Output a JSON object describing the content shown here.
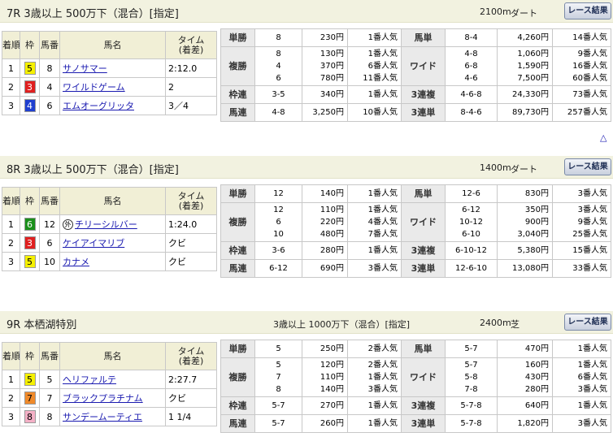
{
  "colors": {
    "header_bg": "#f2f2e0",
    "link": "#1a1ab0",
    "waku5": "#f5f000",
    "waku3": "#e02020",
    "waku4": "#1f3fd0",
    "waku6": "#1a8f1a",
    "waku7": "#f08a2a",
    "waku8": "#f4b0c6"
  },
  "columns": {
    "rank": "着順",
    "frame": "枠",
    "number": "馬番",
    "horse": "馬名",
    "time": "タイム",
    "margin": "(着差)"
  },
  "races": [
    {
      "title": "7R 3歳以上 500万下（混合）[指定]",
      "condition": "",
      "distance": "2100m",
      "surface": "ダート",
      "button": "レース結果",
      "results": [
        {
          "rank": "1",
          "frame": "5",
          "number": "8",
          "horse": "サノサマー",
          "gai": "",
          "time": "2:12.0"
        },
        {
          "rank": "2",
          "frame": "3",
          "number": "4",
          "horse": "ワイルドゲーム",
          "gai": "",
          "time": "2"
        },
        {
          "rank": "3",
          "frame": "4",
          "number": "6",
          "horse": "エムオーグリッタ",
          "gai": "",
          "time": "3／4"
        }
      ],
      "payouts": [
        {
          "l_type": "単勝",
          "l_nums": [
            "8"
          ],
          "l_yen": [
            "230円"
          ],
          "l_pop": [
            "1番人気"
          ],
          "r_type": "馬単",
          "r_nums": [
            "8-4"
          ],
          "r_yen": [
            "4,260円"
          ],
          "r_pop": [
            "14番人気"
          ]
        },
        {
          "l_type": "複勝",
          "l_nums": [
            "8",
            "4",
            "6"
          ],
          "l_yen": [
            "130円",
            "370円",
            "780円"
          ],
          "l_pop": [
            "1番人気",
            "6番人気",
            "11番人気"
          ],
          "r_type": "ワイド",
          "r_nums": [
            "4-8",
            "6-8",
            "4-6"
          ],
          "r_yen": [
            "1,060円",
            "1,590円",
            "7,500円"
          ],
          "r_pop": [
            "9番人気",
            "16番人気",
            "60番人気"
          ]
        },
        {
          "l_type": "枠連",
          "l_nums": [
            "3-5"
          ],
          "l_yen": [
            "340円"
          ],
          "l_pop": [
            "1番人気"
          ],
          "r_type": "3連複",
          "r_nums": [
            "4-6-8"
          ],
          "r_yen": [
            "24,330円"
          ],
          "r_pop": [
            "73番人気"
          ]
        },
        {
          "l_type": "馬連",
          "l_nums": [
            "4-8"
          ],
          "l_yen": [
            "3,250円"
          ],
          "l_pop": [
            "10番人気"
          ],
          "r_type": "3連単",
          "r_nums": [
            "8-4-6"
          ],
          "r_yen": [
            "89,730円"
          ],
          "r_pop": [
            "257番人気"
          ]
        }
      ]
    },
    {
      "title": "8R 3歳以上 500万下（混合）[指定]",
      "condition": "",
      "distance": "1400m",
      "surface": "ダート",
      "button": "レース結果",
      "results": [
        {
          "rank": "1",
          "frame": "6",
          "number": "12",
          "horse": "チリーシルバー",
          "gai": "外",
          "time": "1:24.0"
        },
        {
          "rank": "2",
          "frame": "3",
          "number": "6",
          "horse": "ケイアイマリブ",
          "gai": "",
          "time": "クビ"
        },
        {
          "rank": "3",
          "frame": "5",
          "number": "10",
          "horse": "カナメ",
          "gai": "",
          "time": "クビ"
        }
      ],
      "payouts": [
        {
          "l_type": "単勝",
          "l_nums": [
            "12"
          ],
          "l_yen": [
            "140円"
          ],
          "l_pop": [
            "1番人気"
          ],
          "r_type": "馬単",
          "r_nums": [
            "12-6"
          ],
          "r_yen": [
            "830円"
          ],
          "r_pop": [
            "3番人気"
          ]
        },
        {
          "l_type": "複勝",
          "l_nums": [
            "12",
            "6",
            "10"
          ],
          "l_yen": [
            "110円",
            "220円",
            "480円"
          ],
          "l_pop": [
            "1番人気",
            "4番人気",
            "7番人気"
          ],
          "r_type": "ワイド",
          "r_nums": [
            "6-12",
            "10-12",
            "6-10"
          ],
          "r_yen": [
            "350円",
            "900円",
            "3,040円"
          ],
          "r_pop": [
            "3番人気",
            "9番人気",
            "25番人気"
          ]
        },
        {
          "l_type": "枠連",
          "l_nums": [
            "3-6"
          ],
          "l_yen": [
            "280円"
          ],
          "l_pop": [
            "1番人気"
          ],
          "r_type": "3連複",
          "r_nums": [
            "6-10-12"
          ],
          "r_yen": [
            "5,380円"
          ],
          "r_pop": [
            "15番人気"
          ]
        },
        {
          "l_type": "馬連",
          "l_nums": [
            "6-12"
          ],
          "l_yen": [
            "690円"
          ],
          "l_pop": [
            "3番人気"
          ],
          "r_type": "3連単",
          "r_nums": [
            "12-6-10"
          ],
          "r_yen": [
            "13,080円"
          ],
          "r_pop": [
            "33番人気"
          ]
        }
      ]
    },
    {
      "title": "9R 本栖湖特別",
      "condition": "3歳以上 1000万下（混合）[指定]",
      "distance": "2400m",
      "surface": "芝",
      "button": "レース結果",
      "results": [
        {
          "rank": "1",
          "frame": "5",
          "number": "5",
          "horse": "ヘリファルテ",
          "gai": "",
          "time": "2:27.7"
        },
        {
          "rank": "2",
          "frame": "7",
          "number": "7",
          "horse": "ブラックプラチナム",
          "gai": "",
          "time": "クビ"
        },
        {
          "rank": "3",
          "frame": "8",
          "number": "8",
          "horse": "サンデームーティエ",
          "gai": "",
          "time": "1 1/4"
        }
      ],
      "payouts": [
        {
          "l_type": "単勝",
          "l_nums": [
            "5"
          ],
          "l_yen": [
            "250円"
          ],
          "l_pop": [
            "2番人気"
          ],
          "r_type": "馬単",
          "r_nums": [
            "5-7"
          ],
          "r_yen": [
            "470円"
          ],
          "r_pop": [
            "1番人気"
          ]
        },
        {
          "l_type": "複勝",
          "l_nums": [
            "5",
            "7",
            "8"
          ],
          "l_yen": [
            "120円",
            "110円",
            "140円"
          ],
          "l_pop": [
            "2番人気",
            "1番人気",
            "3番人気"
          ],
          "r_type": "ワイド",
          "r_nums": [
            "5-7",
            "5-8",
            "7-8"
          ],
          "r_yen": [
            "160円",
            "430円",
            "280円"
          ],
          "r_pop": [
            "1番人気",
            "6番人気",
            "3番人気"
          ]
        },
        {
          "l_type": "枠連",
          "l_nums": [
            "5-7"
          ],
          "l_yen": [
            "270円"
          ],
          "l_pop": [
            "1番人気"
          ],
          "r_type": "3連複",
          "r_nums": [
            "5-7-8"
          ],
          "r_yen": [
            "640円"
          ],
          "r_pop": [
            "1番人気"
          ]
        },
        {
          "l_type": "馬連",
          "l_nums": [
            "5-7"
          ],
          "l_yen": [
            "260円"
          ],
          "l_pop": [
            "1番人気"
          ],
          "r_type": "3連単",
          "r_nums": [
            "5-7-8"
          ],
          "r_yen": [
            "1,820円"
          ],
          "r_pop": [
            "3番人気"
          ]
        }
      ]
    }
  ],
  "scroll_top": "△"
}
